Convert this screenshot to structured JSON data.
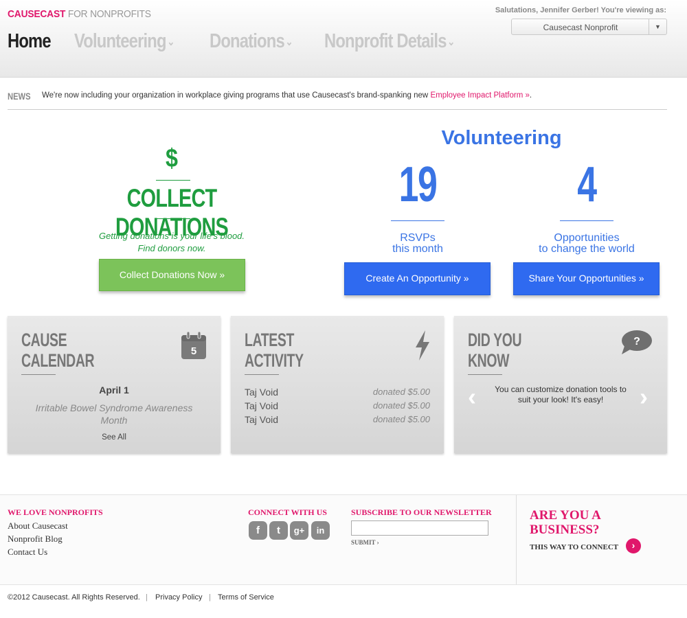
{
  "header": {
    "brand_main": "CAUSECAST",
    "brand_sub": " FOR NONPROFITS",
    "greeting": "Salutations, Jennifer Gerber! You're viewing as:",
    "org_select": "Causecast Nonprofit",
    "nav": [
      {
        "label": "Home"
      },
      {
        "label": "Volunteering"
      },
      {
        "label": "Donations"
      },
      {
        "label": "Nonprofit Details"
      }
    ]
  },
  "news": {
    "label": "NEWS",
    "text": "We're now including your organization in workplace giving programs that use Causecast's brand-spanking new ",
    "link": "Employee Impact Platform »",
    "end": "."
  },
  "donations": {
    "symbol": "$",
    "title": "COLLECT DONATIONS",
    "subtitle_1": "Getting donations is your life's blood.",
    "subtitle_2": "Find donors now.",
    "button": "Collect Donations Now »"
  },
  "volunteering": {
    "title": "Volunteering",
    "stats": [
      {
        "value": "19",
        "label_1": "RSVPs",
        "label_2": "this month",
        "button": "Create An Opportunity »"
      },
      {
        "value": "4",
        "label_1": "Opportunities",
        "label_2": "to change the world",
        "button": "Share Your Opportunities »"
      }
    ]
  },
  "calendar": {
    "title_1": "CAUSE",
    "title_2": "CALENDAR",
    "icon_day": "5",
    "date": "April 1",
    "event": "Irritable Bowel Syndrome Awareness Month",
    "see_all": "See All"
  },
  "activity": {
    "title_1": "LATEST",
    "title_2": "ACTIVITY",
    "rows": [
      {
        "name": "Taj Void",
        "action": "donated $5.00"
      },
      {
        "name": "Taj Void",
        "action": "donated $5.00"
      },
      {
        "name": "Taj Void",
        "action": "donated $5.00"
      }
    ]
  },
  "did_you_know": {
    "title_1": "DID YOU",
    "title_2": "KNOW",
    "icon_glyph": "?",
    "text": "You can customize donation tools to suit your look! It's easy!"
  },
  "footer": {
    "love_heading": "WE LOVE NONPROFITS",
    "links": [
      "About Causecast",
      "Nonprofit Blog",
      "Contact Us"
    ],
    "connect_heading": "CONNECT WITH US",
    "social": [
      {
        "icon": "facebook-icon",
        "glyph": "f"
      },
      {
        "icon": "twitter-icon",
        "glyph": "t"
      },
      {
        "icon": "google-plus-icon",
        "glyph": "g+"
      },
      {
        "icon": "linkedin-icon",
        "glyph": "in"
      }
    ],
    "newsletter_heading": "SUBSCRIBE TO OUR NEWSLETTER",
    "submit": "SUBMIT ›",
    "biz_title_1": "ARE YOU A",
    "biz_title_2": "BUSINESS?",
    "biz_link": "THIS WAY TO CONNECT",
    "copyright": "©2012 Causecast. All Rights Reserved.",
    "privacy": "Privacy Policy",
    "terms": "Terms of Service"
  },
  "colors": {
    "brand_pink": "#e0176b",
    "donation_green": "#1f9d3f",
    "volunteer_blue": "#3a74e4"
  }
}
